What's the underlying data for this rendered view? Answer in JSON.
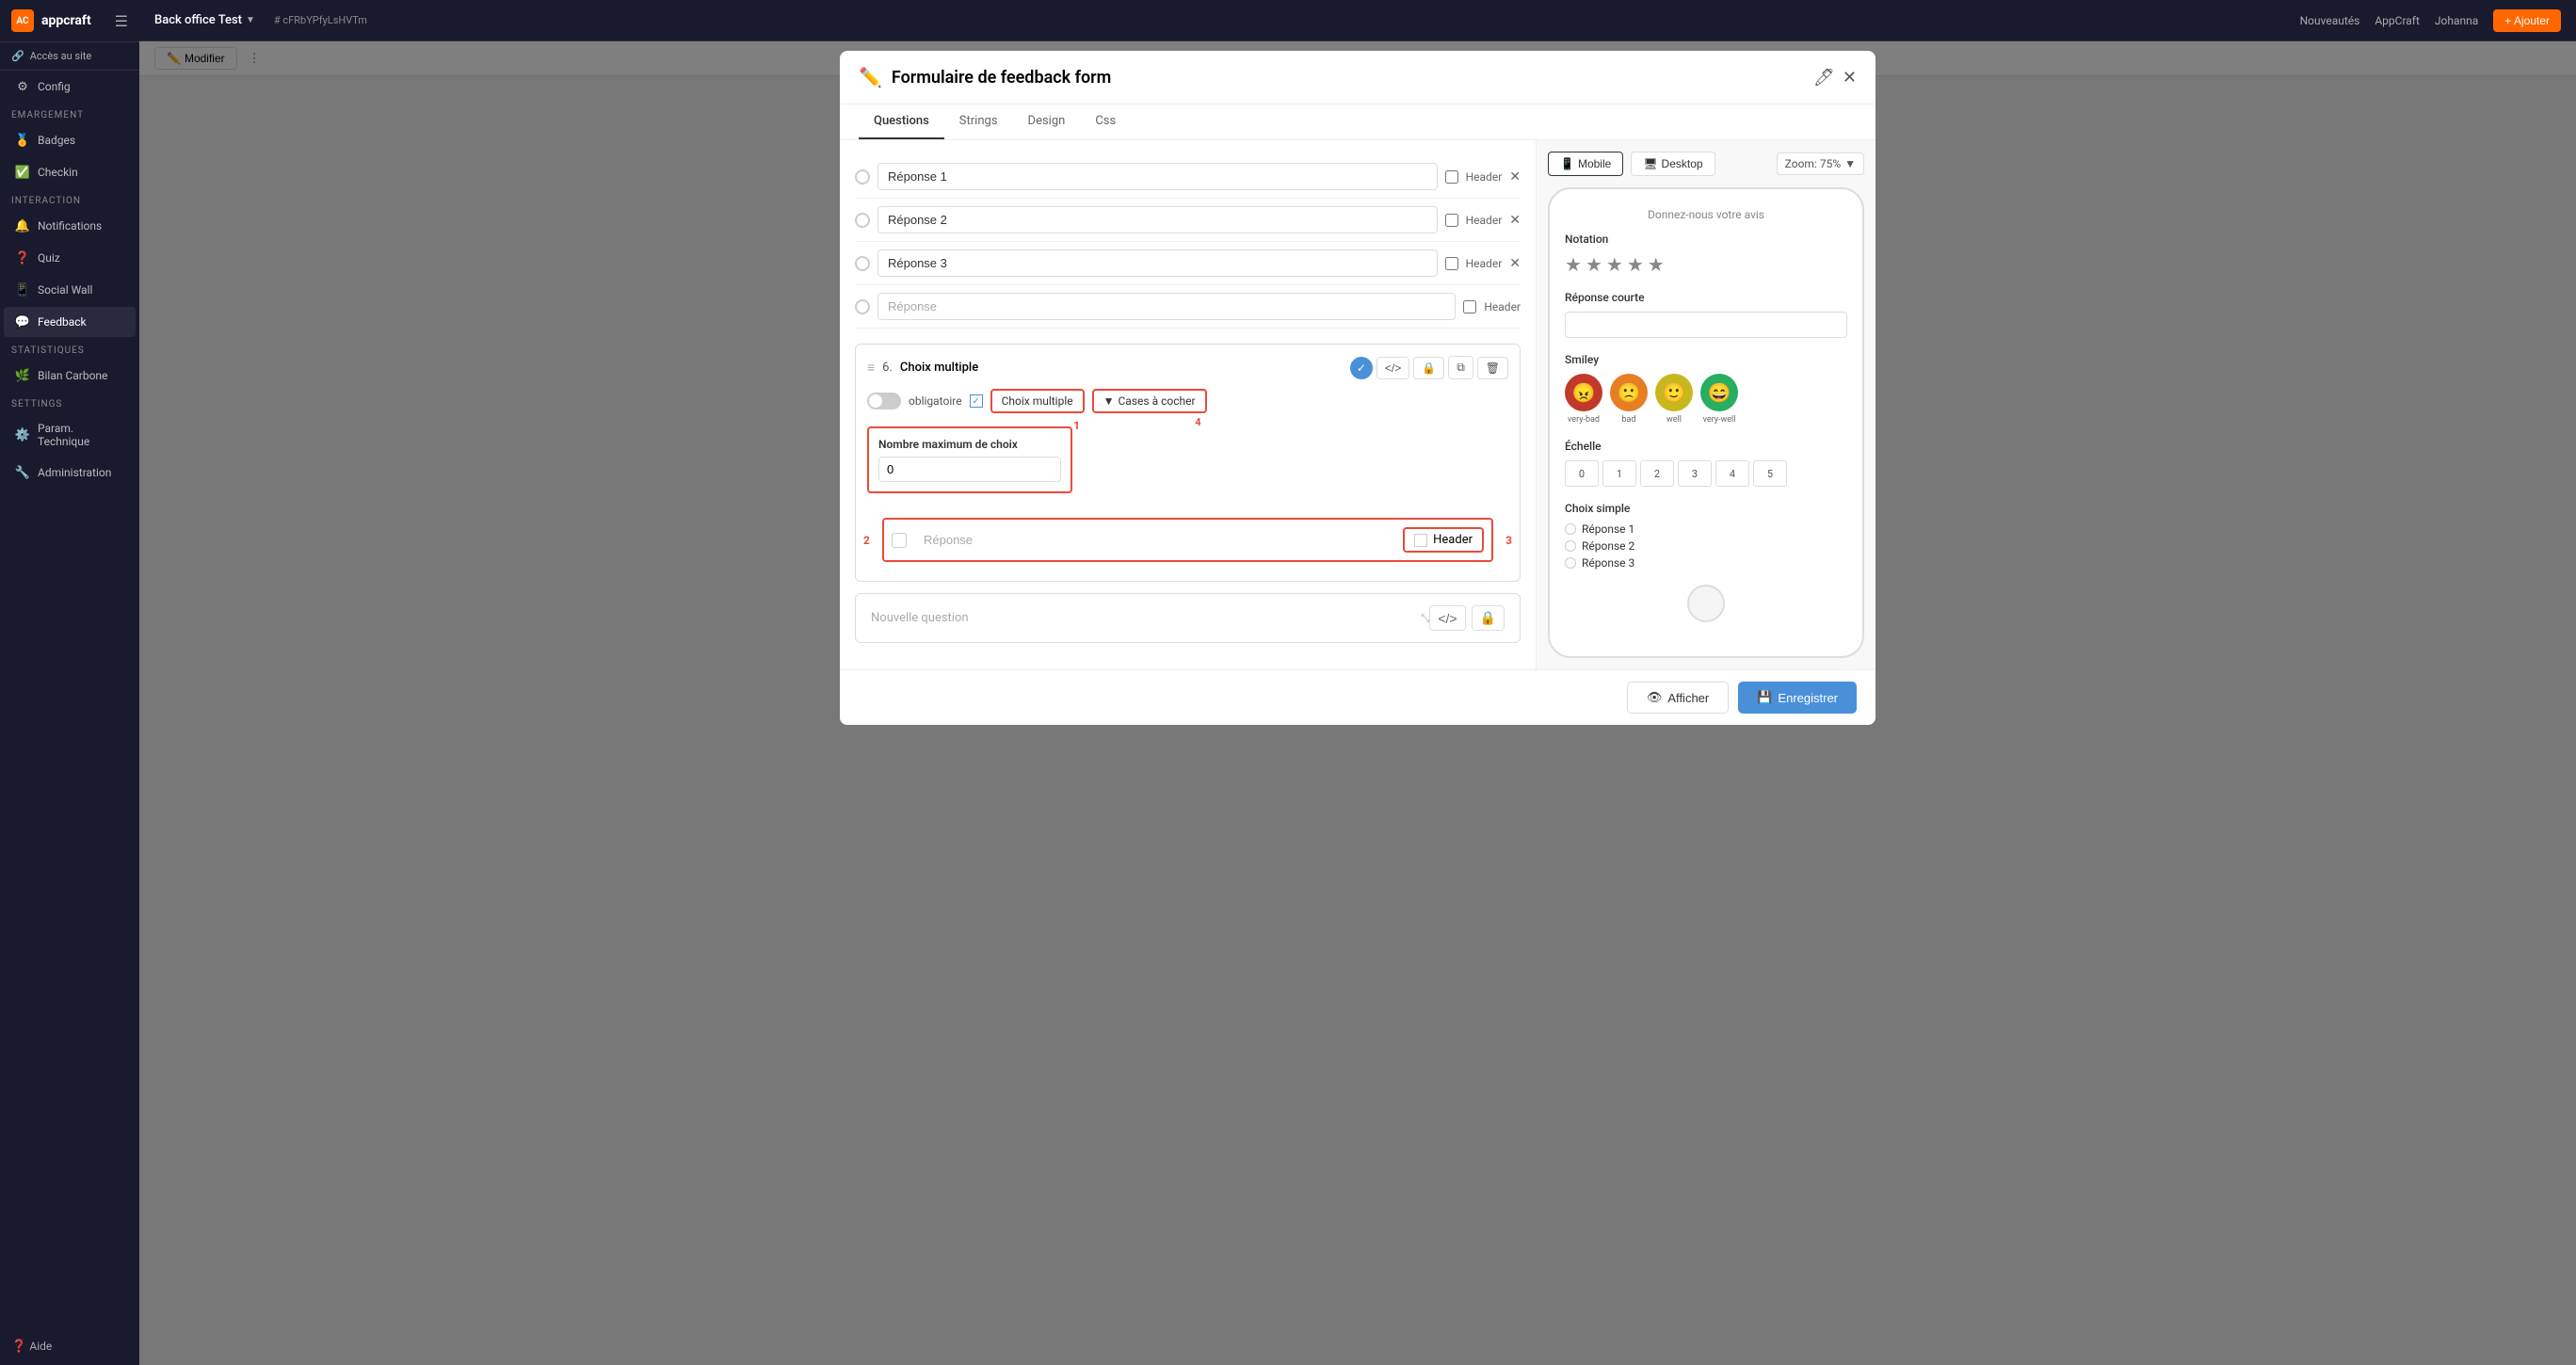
{
  "app": {
    "logo": "AC",
    "name": "appcraft",
    "project_title": "Back office Test",
    "project_hash": "# cFRbYPfyLsHVTm",
    "nav_new": "Nouveautés",
    "nav_appcraft": "AppCraft",
    "nav_user": "Johanna",
    "add_btn": "+ Ajouter",
    "modifier_btn": "Modifier"
  },
  "sidebar": {
    "access_btn": "Accès au site",
    "config_label": "Config",
    "sections": [
      {
        "label": "EMARGEMENT",
        "items": [
          {
            "id": "badges",
            "label": "Badges",
            "icon": "🏅"
          },
          {
            "id": "checkin",
            "label": "Checkin",
            "icon": "✅"
          }
        ]
      },
      {
        "label": "INTERACTION",
        "items": [
          {
            "id": "notifications",
            "label": "Notifications",
            "icon": "🔔"
          },
          {
            "id": "quiz",
            "label": "Quiz",
            "icon": "❓"
          },
          {
            "id": "social-wall",
            "label": "Social Wall",
            "icon": "📱"
          },
          {
            "id": "feedback",
            "label": "Feedback",
            "icon": "💬"
          }
        ]
      },
      {
        "label": "STATISTIQUES",
        "items": [
          {
            "id": "bilan-carbone",
            "label": "Bilan Carbone",
            "icon": "🌿"
          }
        ]
      },
      {
        "label": "SETTINGS",
        "items": [
          {
            "id": "param-technique",
            "label": "Param. Technique",
            "icon": "⚙️"
          },
          {
            "id": "administration",
            "label": "Administration",
            "icon": "🔧"
          }
        ]
      }
    ],
    "aide_label": "Aide"
  },
  "modal": {
    "title": "Formulaire de feedback form",
    "tabs": [
      "Questions",
      "Strings",
      "Design",
      "Css"
    ],
    "active_tab": "Questions",
    "responses": [
      {
        "id": 1,
        "value": "Réponse 1",
        "header": false
      },
      {
        "id": 2,
        "value": "Réponse 2",
        "header": false
      },
      {
        "id": 3,
        "value": "Réponse 3",
        "header": false
      },
      {
        "id": 4,
        "value": "",
        "placeholder": "Réponse",
        "header": false
      }
    ],
    "question6": {
      "number": "6.",
      "type": "Choix multiple",
      "obligatoire_label": "obligatoire",
      "choix_multiple_label": "Choix multiple",
      "cases_a_cocher_label": "Cases à cocher",
      "max_choix_label": "Nombre maximum de choix",
      "max_choix_value": "0",
      "response_placeholder": "Réponse",
      "header_label": "Header",
      "annotations": {
        "1": "1",
        "2": "2",
        "3": "3",
        "4": "4"
      }
    },
    "nouvelle_question": "Nouvelle question",
    "footer": {
      "afficher_label": "Afficher",
      "enregistrer_label": "Enregistrer"
    }
  },
  "preview": {
    "mobile_label": "Mobile",
    "desktop_label": "Desktop",
    "zoom_label": "Zoom: 75%",
    "heading": "Donnez-nous votre avis",
    "sections": [
      {
        "id": "notation",
        "title": "Notation",
        "type": "stars",
        "count": 5
      },
      {
        "id": "reponse-courte",
        "title": "Réponse courte",
        "type": "input"
      },
      {
        "id": "smiley",
        "title": "Smiley",
        "type": "smiley",
        "items": [
          {
            "emoji": "😠",
            "label": "very-bad",
            "color": "#c0392b"
          },
          {
            "emoji": "🙁",
            "label": "bad",
            "color": "#e67e22"
          },
          {
            "emoji": "🙂",
            "label": "well",
            "color": "#c8b820"
          },
          {
            "emoji": "😄",
            "label": "very-well",
            "color": "#27ae60"
          }
        ]
      },
      {
        "id": "echelle",
        "title": "Échelle",
        "type": "scale",
        "values": [
          "0",
          "1",
          "2",
          "3",
          "4",
          "5"
        ]
      },
      {
        "id": "choix-simple",
        "title": "Choix simple",
        "type": "choices",
        "options": [
          "Réponse 1",
          "Réponse 2",
          "Réponse 3"
        ]
      }
    ]
  }
}
